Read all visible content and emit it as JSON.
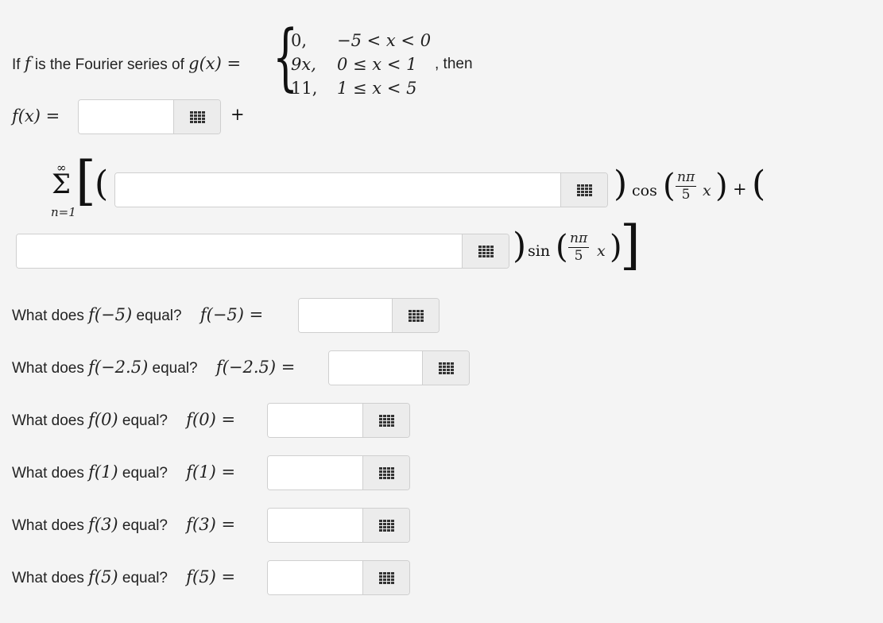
{
  "intro": {
    "prefix": "If",
    "f": "f",
    "middle": "is the Fourier series of",
    "g_of_x": "g(x) =",
    "suffix": ", then"
  },
  "cases": [
    {
      "value": "0,",
      "condition": "−5 < x < 0"
    },
    {
      "value": "9x,",
      "condition": "0 ≤ x < 1"
    },
    {
      "value": "11,",
      "condition": "1 ≤ x < 5"
    }
  ],
  "formula": {
    "fx_label": "f(x) =",
    "plus": "+",
    "sum_upper": "∞",
    "sum_symbol": "Σ",
    "sum_lower": "n=1",
    "cos": "cos",
    "sin": "sin",
    "frac_num": "nπ",
    "frac_den": "5",
    "var_x": "x",
    "plus2": "+"
  },
  "questions": [
    {
      "prompt": "What does",
      "arg": "f(−5)",
      "tail": "equal?",
      "lhs": "f(−5) ="
    },
    {
      "prompt": "What does",
      "arg": "f(−2.5)",
      "tail": "equal?",
      "lhs": "f(−2.5) ="
    },
    {
      "prompt": "What does",
      "arg": "f(0)",
      "tail": "equal?",
      "lhs": "f(0) ="
    },
    {
      "prompt": "What does",
      "arg": "f(1)",
      "tail": "equal?",
      "lhs": "f(1) ="
    },
    {
      "prompt": "What does",
      "arg": "f(3)",
      "tail": "equal?",
      "lhs": "f(3) ="
    },
    {
      "prompt": "What does",
      "arg": "f(5)",
      "tail": "equal?",
      "lhs": "f(5) ="
    }
  ],
  "inputs": {
    "a0": "",
    "an": "",
    "bn": "",
    "answers": [
      "",
      "",
      "",
      "",
      "",
      ""
    ]
  },
  "icons": {
    "keyboard": "math-keypad-icon"
  }
}
